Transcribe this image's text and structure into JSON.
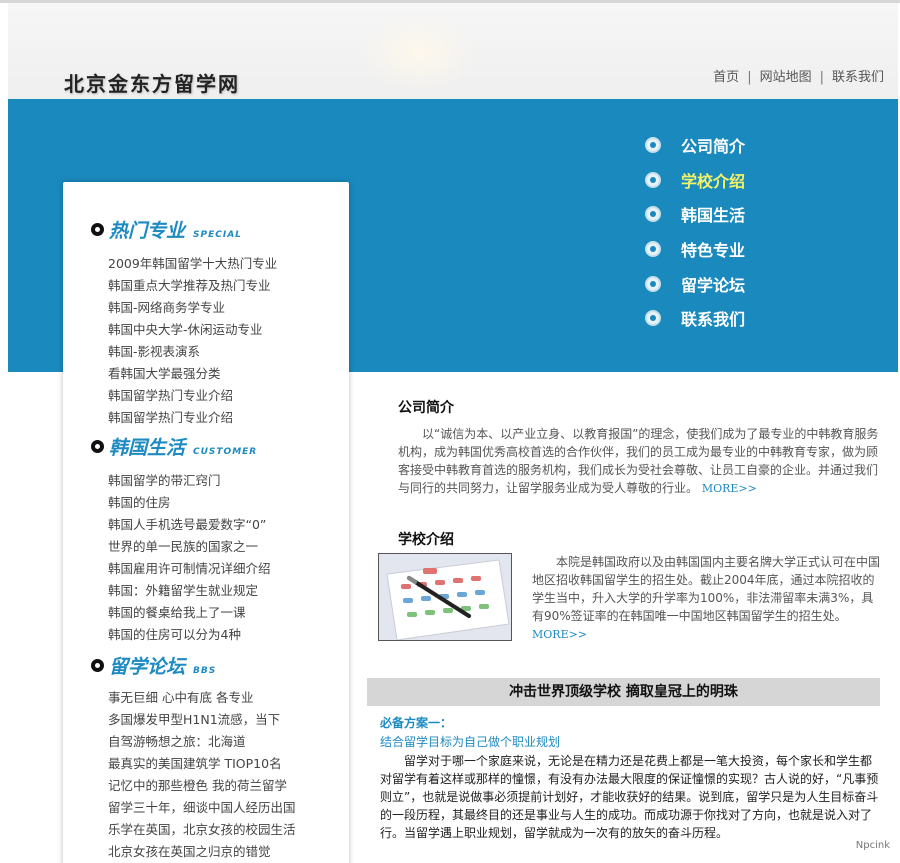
{
  "site": {
    "logo": "北京金东方留学网"
  },
  "topnav": {
    "home": "首页",
    "sitemap": "网站地图",
    "contact": "联系我们",
    "separator": "|"
  },
  "mainnav": [
    {
      "label": "公司简介",
      "active": false
    },
    {
      "label": "学校介绍",
      "active": true
    },
    {
      "label": "韩国生活",
      "active": false
    },
    {
      "label": "特色专业",
      "active": false
    },
    {
      "label": "留学论坛",
      "active": false
    },
    {
      "label": "联系我们",
      "active": false
    }
  ],
  "sidebar": {
    "sections": [
      {
        "title": "热门专业",
        "subtitle": "SPECIAL",
        "links": [
          "2009年韩国留学十大热门专业",
          "韩国重点大学推荐及热门专业",
          "韩国-网络商务学专业",
          "韩国中央大学-休闲运动专业",
          "韩国-影视表演系",
          "看韩国大学最强分类",
          "韩国留学热门专业介绍",
          "韩国留学热门专业介绍"
        ]
      },
      {
        "title": "韩国生活",
        "subtitle": "CUSTOMER",
        "links": [
          "韩国留学的带汇窍门",
          "韩国的住房",
          "韩国人手机选号最爱数字“0”",
          "世界的单一民族的国家之一",
          "韩国雇用许可制情况详细介绍",
          "韩国：外籍留学生就业规定",
          "韩国的餐桌给我上了一课",
          "韩国的住房可以分为4种"
        ]
      },
      {
        "title": "留学论坛",
        "subtitle": "BBS",
        "links": [
          "事无巨细 心中有底 各专业",
          "多国爆发甲型H1N1流感，当下",
          "自驾游畅想之旅：北海道",
          "最真实的美国建筑学 TIOP10名",
          "记忆中的那些橙色 我的荷兰留学",
          "留学三十年，细谈中国人经历出国",
          "乐学在英国，北京女孩的校园生活",
          "北京女孩在英国之归京的错觉"
        ]
      }
    ]
  },
  "about": {
    "title": "公司简介",
    "text": "以“诚信为本、以产业立身、以教育报国”的理念，使我们成为了最专业的中韩教育服务机构，成为韩国优秀高校首选的合作伙伴，我们的员工成为最专业的中韩教育专家，做为顾客接受中韩教育首选的服务机构，我们成长为受社会尊敬、让员工自豪的企业。并通过我们与同行的共同努力，让留学服务业成为受人尊敬的行业。",
    "more": "MORE>>"
  },
  "school": {
    "title": "学校介绍",
    "text": "本院是韩国政府以及由韩国国内主要名牌大学正式认可在中国地区招收韩国留学生的招生处。截止2004年底，通过本院招收的学生当中，升入大学的升学率为100%，非法滞留率未满3%，具有90%签证率的在韩国唯一中国地区韩国留学生的招生处。",
    "more": "MORE>>"
  },
  "feature": {
    "headline": "冲击世界顶级学校 摘取皇冠上的明珠",
    "plan_title": "必备方案一：",
    "plan_subtitle": "结合留学目标为自己做个职业规划",
    "plan_text": "留学对于哪一个家庭来说，无论是在精力还是花费上都是一笔大投资，每个家长和学生都对留学有着这样或那样的憧憬，有没有办法最大限度的保证憧憬的实现？古人说的好，“凡事预则立”，也就是说做事必须提前计划好，才能收获好的结果。说到底，留学只是为人生目标奋斗的一段历程，其最终目的还是事业与人生的成功。而成功源于你找对了方向，也就是说入对了行。当留学遇上职业规划，留学就成为一次有的放矢的奋斗历程。"
  },
  "watermark": "Npcink",
  "colors": {
    "banner": "#1a89be",
    "accent": "#1d8ac2",
    "nav_active": "#f3f36a",
    "strip": "#d6d6d6"
  }
}
